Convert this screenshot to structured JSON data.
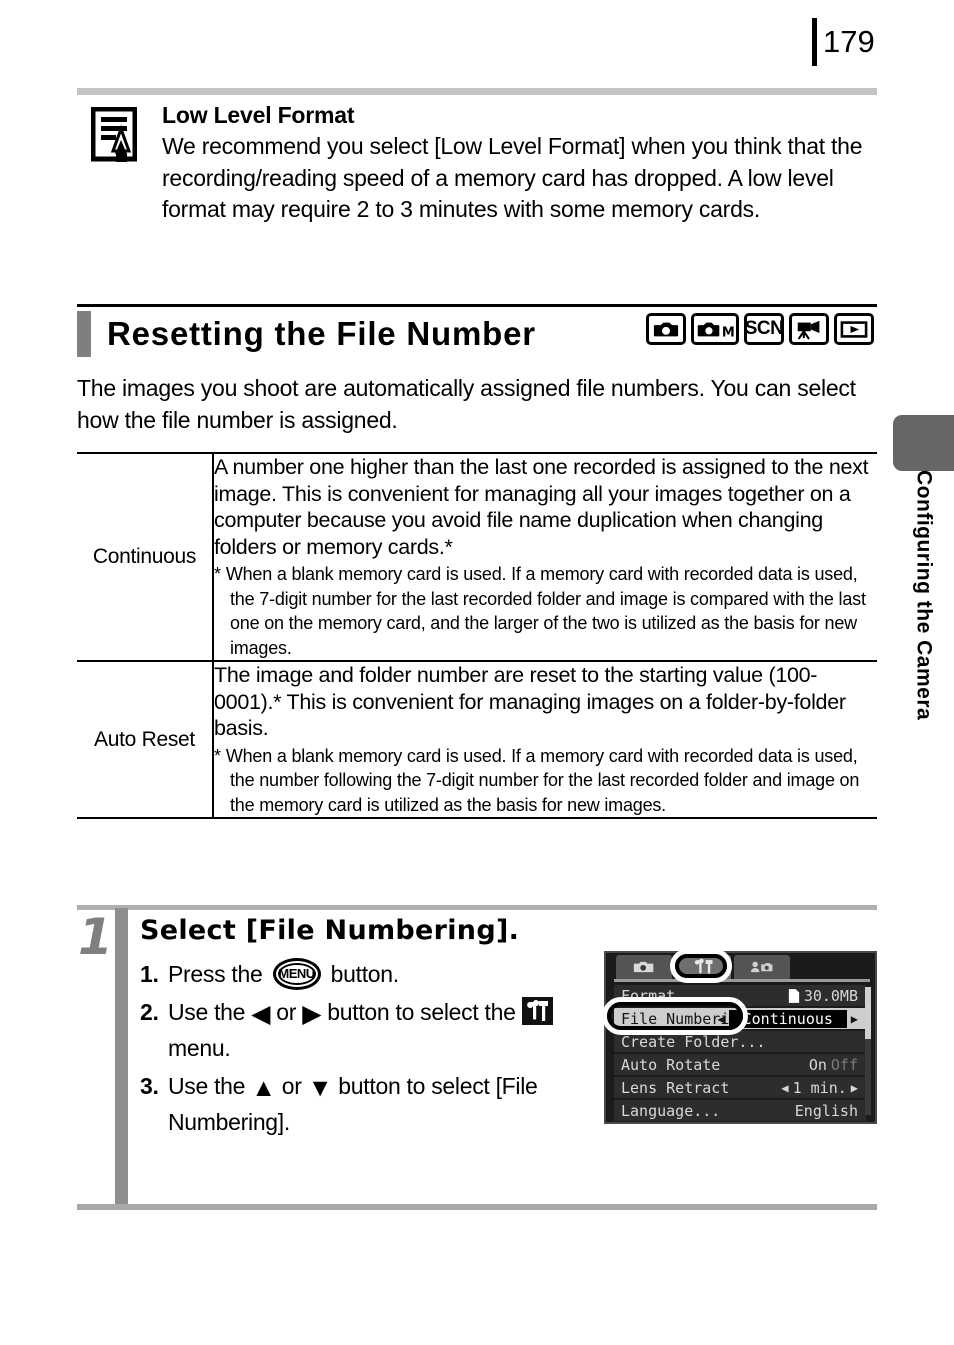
{
  "header": {
    "page_number": "179"
  },
  "note": {
    "icon": "memo-pencil-icon",
    "title": "Low Level Format",
    "text": "We recommend you select [Low Level Format] when you think that the recording/reading speed of a memory card has dropped. A low level format may require 2 to 3 minutes with some memory cards."
  },
  "section": {
    "title": "Resetting the File Number",
    "mode_icons": [
      "camera-icon",
      "camera-manual-icon",
      "scn-icon",
      "movie-icon",
      "playback-icon"
    ],
    "scn_label": "SCN",
    "m_label": "M",
    "intro": "The images you shoot are automatically assigned file numbers. You can select how the file number is assigned."
  },
  "table": {
    "rows": [
      {
        "label": "Continuous",
        "main": "A number one higher than the last one recorded is assigned to the next image. This is convenient for managing all your images together on a computer because you avoid file name duplication when changing folders or memory cards.*",
        "footnote_marker": "*",
        "footnote": "When a blank memory card is used. If a memory card with recorded data is used, the 7-digit number for the last recorded folder and image is compared with the last one on the memory card, and the larger of the two is utilized as the basis for new images."
      },
      {
        "label": "Auto Reset",
        "main": "The image and folder number are reset to the starting value (100-0001).* This is convenient for managing images on a folder-by-folder basis.",
        "footnote_marker": "*",
        "footnote": "When a blank memory card is used. If a memory card with recorded data is used, the number following the 7-digit number for the last recorded folder and image on the memory card is utilized as the basis for new images."
      }
    ]
  },
  "step": {
    "number": "1",
    "title": "Select [File Numbering].",
    "substeps": [
      {
        "n": "1.",
        "pre": "Press the ",
        "button": "MENU",
        "post": " button."
      },
      {
        "n": "2.",
        "pre": "Use the ",
        "arrow_left": "◀",
        "mid": " or ",
        "arrow_right": "▶",
        "post": " button to select the ",
        "menu_icon": "tools-menu-icon",
        "tail": " menu."
      },
      {
        "n": "3.",
        "pre": "Use the ",
        "arrow_up": "▲",
        "mid": " or ",
        "arrow_down": "▼",
        "post": " button to select [File Numbering]."
      }
    ]
  },
  "lcd": {
    "tabs": [
      "camera-tab-icon",
      "tools-tab-icon",
      "mycamera-tab-icon"
    ],
    "active_tab_index": 1,
    "rows": [
      {
        "label": "Format",
        "value": "30.0MB",
        "icon": "card-icon",
        "selected": false,
        "partial": true
      },
      {
        "label": "File Numberin",
        "value": "Continuous",
        "selected": true,
        "has_chevrons": true
      },
      {
        "label": "Create Folder...",
        "value": "",
        "selected": false,
        "partial": true
      },
      {
        "label": "Auto Rotate",
        "value": "On",
        "value2": "Off",
        "selected": false
      },
      {
        "label": "Lens Retract",
        "value": "1 min.",
        "selected": false,
        "has_chevrons": true
      },
      {
        "label": "Language...",
        "value": "English",
        "selected": false
      }
    ],
    "chevron_left": "◀",
    "chevron_right": "▶"
  },
  "side_tab": {
    "label": "Configuring the Camera"
  },
  "colors": {
    "rule_gray": "#c4c4c4",
    "section_bar": "#7f7f7f",
    "step_bar": "#8e8e8e",
    "side_tab": "#666666",
    "lcd_bg": "#1b1b1b"
  }
}
